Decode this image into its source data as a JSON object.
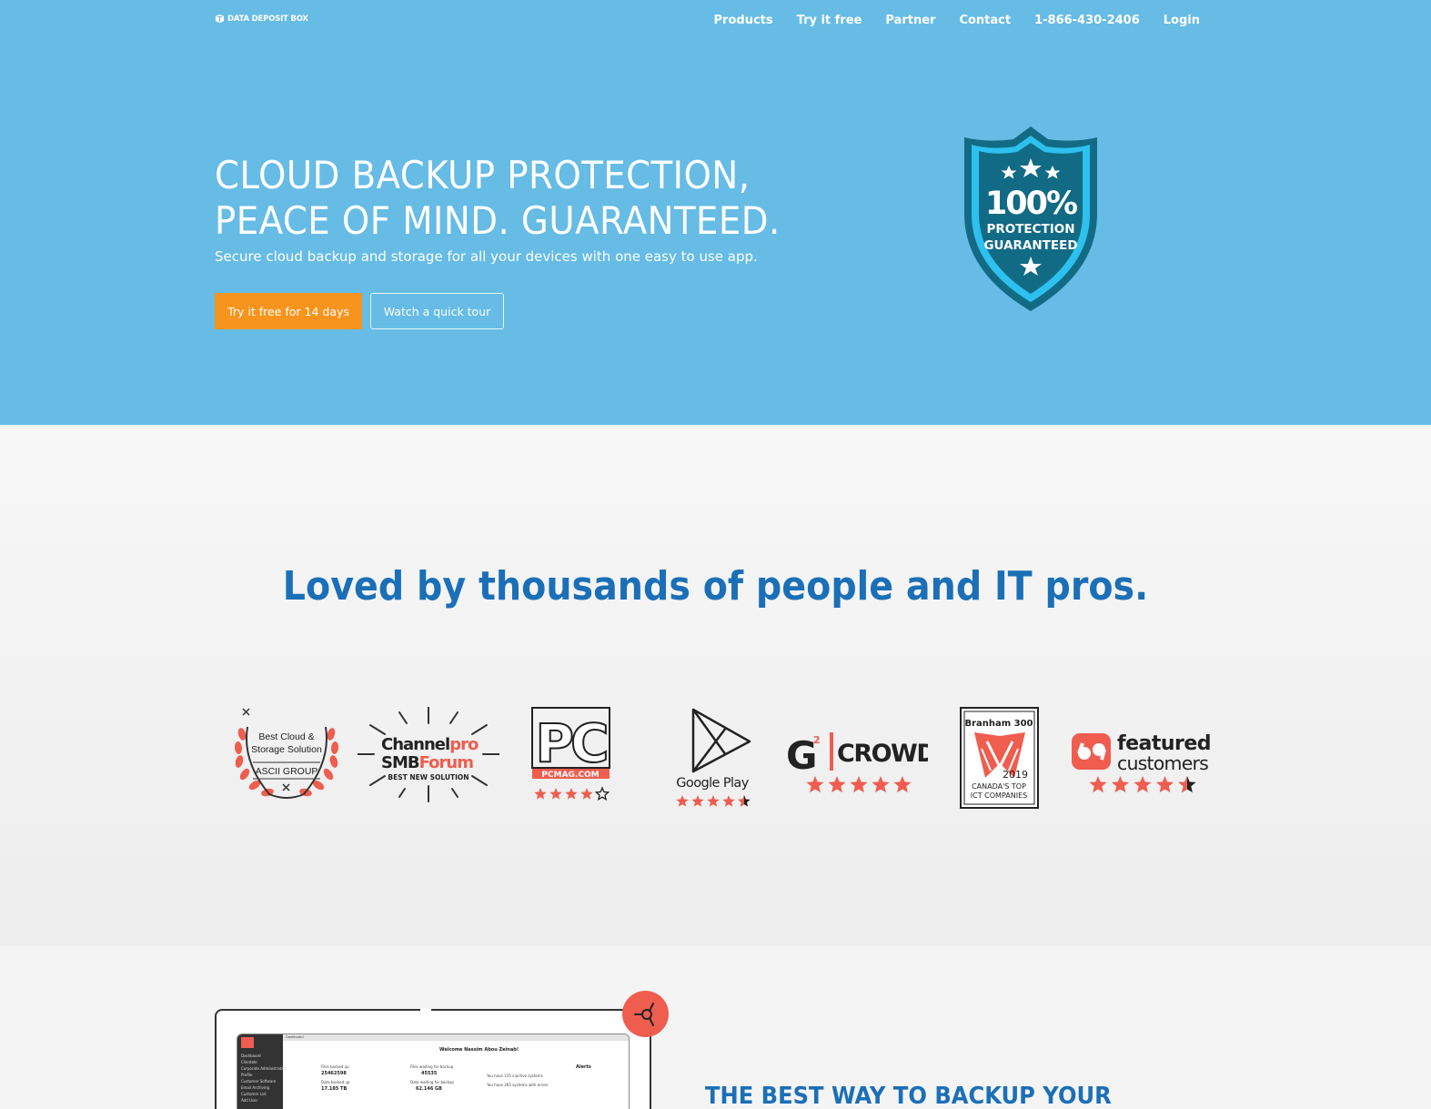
{
  "brand": {
    "name": "DATA DEPOSIT BOX"
  },
  "nav": {
    "items": [
      "Products",
      "Try it free",
      "Partner",
      "Contact",
      "1-866-430-2406",
      "Login"
    ]
  },
  "hero": {
    "headline_line1": "CLOUD BACKUP PROTECTION,",
    "headline_line2": "PEACE OF MIND. GUARANTEED.",
    "subheadline": "Secure cloud backup and storage for all your devices with one easy to use app.",
    "primary_cta": "Try it free for 14 days",
    "secondary_cta": "Watch a quick tour",
    "shield": {
      "line1": "100%",
      "line2": "PROTECTION",
      "line3": "GUARANTEED"
    }
  },
  "awards": {
    "title": "Loved by thousands of people and IT pros.",
    "ascii": {
      "line1": "Best Cloud &",
      "line2": "Storage Solution",
      "line3": "ASCII GROUP"
    },
    "channelpro": {
      "line1a": "Channel",
      "line1b": "pro",
      "line2a": "SMB",
      "line2b": "Forum",
      "line3": "BEST NEW SOLUTION"
    },
    "pcmag": {
      "logo": "PC",
      "domain": "PCMAG.COM",
      "rating": 4
    },
    "googleplay": {
      "label": "Google Play",
      "rating": 4.5
    },
    "g2crowd": {
      "logo_g": "G",
      "logo_sup": "2",
      "logo_text": "CROWD",
      "rating": 5
    },
    "branham": {
      "line1": "Branham 300",
      "year": "2019",
      "line2": "CANADA'S TOP",
      "line3": "ICT COMPANIES"
    },
    "featured": {
      "line1": "featured",
      "line2": "customers",
      "rating": 4.5
    }
  },
  "product": {
    "title": "THE BEST WAY TO BACKUP YOUR",
    "dashboard": {
      "tab": "Dashboard",
      "welcome": "Welcome Nassim Abou Zeinab!",
      "files_label": "Files backed up",
      "files_value": "25462598",
      "waiting_label": "Files waiting for backup",
      "waiting_value": "45535",
      "data_label": "Data backed up",
      "data_value": "17.185 TB",
      "data_waiting_label": "Data waiting for backup",
      "data_waiting_value": "62.146 GB",
      "alerts": "Alerts",
      "alert1": "You have 135 inactive systems",
      "alert2": "You have 265 systems with errors",
      "sidebar": [
        "Dashboard",
        "Clientele",
        "Corporate Administration",
        "Profile",
        "Customer Software",
        "Email Archiving",
        "Customer List",
        "Add User"
      ]
    }
  },
  "colors": {
    "hero_bg": "#66bce5",
    "cta_orange": "#f7941d",
    "title_blue": "#1b6fb7",
    "shield_dark": "#126b84",
    "shield_light": "#2ec0ee",
    "award_red": "#ef5d4f"
  }
}
